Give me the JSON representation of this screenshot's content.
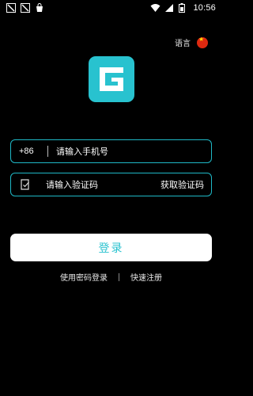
{
  "status_bar": {
    "time": "10:56"
  },
  "language": {
    "label": "语言"
  },
  "login_form": {
    "country_code": "+86",
    "phone_placeholder": "请输入手机号",
    "code_placeholder": "请输入验证码",
    "get_code_label": "获取验证码",
    "login_button": "登录"
  },
  "links": {
    "password_login": "使用密码登录",
    "quick_register": "快速注册"
  },
  "colors": {
    "accent": "#28c2cf",
    "background": "#000000"
  }
}
